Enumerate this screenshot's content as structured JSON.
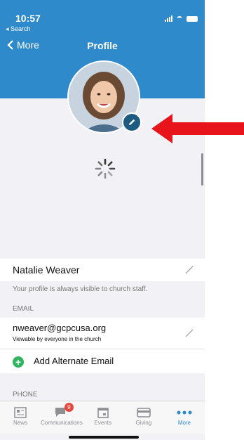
{
  "status_bar": {
    "time": "10:57",
    "back_app": "◂ Search"
  },
  "nav": {
    "back_label": "More",
    "title": "Profile"
  },
  "profile": {
    "name": "Natalie Weaver",
    "visibility_note": "Your profile is always visible to church staff."
  },
  "email_section": {
    "header": "EMAIL",
    "address": "nweaver@gcpcusa.org",
    "visibility": "Viewable by everyone in the church",
    "add_label": "Add Alternate Email"
  },
  "phone_section": {
    "header": "PHONE"
  },
  "tabbar": {
    "tabs": [
      {
        "label": "News",
        "icon": "news-icon"
      },
      {
        "label": "Communications",
        "icon": "chat-icon",
        "badge": "9"
      },
      {
        "label": "Events",
        "icon": "calendar-icon"
      },
      {
        "label": "Giving",
        "icon": "card-icon"
      },
      {
        "label": "More",
        "icon": "more-icon",
        "active": true
      }
    ]
  },
  "colors": {
    "header_blue": "#2f8acb",
    "edit_badge": "#1d5b80",
    "arrow_red": "#e8141b",
    "add_green": "#2fb560"
  }
}
